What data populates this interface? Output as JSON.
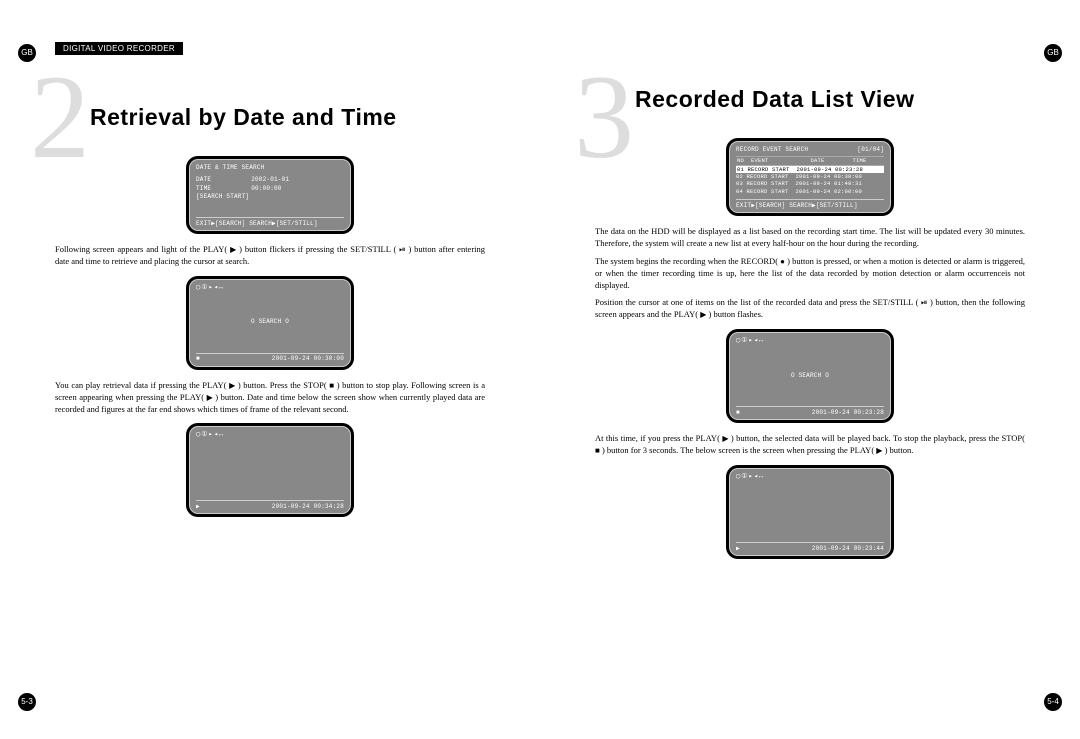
{
  "header": {
    "top_bar": "DIGITAL VIDEO RECORDER",
    "gb_label": "GB"
  },
  "left": {
    "big_number": "2",
    "title": "Retrieval by Date and Time",
    "screen1": {
      "title": "DATE & TIME SEARCH",
      "date_label": "DATE",
      "date_value": "2002-01-01",
      "time_label": "TIME",
      "time_value": "00:00:00",
      "search_start": "[SEARCH START]",
      "footer": "EXIT▶[SEARCH] SEARCH▶[SET/STILL]"
    },
    "para1_a": "Following screen appears and light of the PLAY(",
    "para1_b": ") button flickers if pressing the SET/STILL (",
    "para1_c": ") button after entering date and time to retrieve and placing the cursor at search.",
    "screen2": {
      "icons": "◯①▸◂↔",
      "center": "O  SEARCH  O",
      "stop_icon": "■",
      "timestamp": "2001-09-24 00:30:00"
    },
    "para2_a": "You can play retrieval data if pressing the PLAY(",
    "para2_b": ") button. Press the STOP(",
    "para2_c": ") button to stop play. Following screen is a screen appearing when pressing the PLAY(",
    "para2_d": ") button. Date and time below the screen show when currently played data are recorded and figures at the far end shows which times of frame of the relevant second.",
    "screen3": {
      "icons": "◯①▸◂↔",
      "play_icon": "▶",
      "timestamp": "2001-09-24 00:34:28"
    },
    "footer_page": "5-3"
  },
  "right": {
    "big_number": "3",
    "title": "Recorded Data List View",
    "screen1": {
      "header_left": "RECORD EVENT SEARCH",
      "header_right": "[01/04]",
      "col_hdr": "NO  EVENT            DATE        TIME",
      "rows": [
        "01 RECORD START  2001-09-24 00:23:28",
        "02 RECORD START  2001-09-24 00:30:00",
        "03 RECORD START  2001-09-24 01:49:31",
        "04 RECORD START  2001-09-24 02:00:00"
      ],
      "footer": "EXIT▶[SEARCH] SEARCH▶[SET/STILL]"
    },
    "para1": "The data on the HDD will be displayed as a list based on the recording start time. The list will be updated every 30 minutes. Therefore, the system will create a new list at every half-hour on the hour during the recording.",
    "para2_a": "The system begins the recording when the RECORD(",
    "para2_b": ") button is pressed, or when a motion is detected or alarm is triggered, or when the timer recording time is up, here the list of the data recorded by motion detection or alarm occurrenceis not displayed.",
    "para3_a": "Position the cursor at one of items on the list of the recorded data and press the SET/STILL (",
    "para3_b": ") button, then the following screen appears and the PLAY(",
    "para3_c": ") button flashes.",
    "screen2": {
      "icons": "◯①▸◂↔",
      "center": "O SEARCH O",
      "stop_icon": "■",
      "timestamp": "2001-09-24 00:23:28"
    },
    "para4_a": "At this time, if you press the PLAY(",
    "para4_b": ") button, the selected data will be played back. To stop the playback, press the STOP(",
    "para4_c": ") button for 3 seconds. The below screen is the screen when pressing the PLAY(",
    "para4_d": ") button.",
    "screen3": {
      "icons": "◯①▸◂↔",
      "play_icon": "▶",
      "timestamp": "2001-09-24 00:23:44"
    },
    "footer_page": "5-4"
  },
  "glyphs": {
    "play": "▶",
    "stop": "■",
    "record": "●",
    "setstill": "⏯"
  }
}
